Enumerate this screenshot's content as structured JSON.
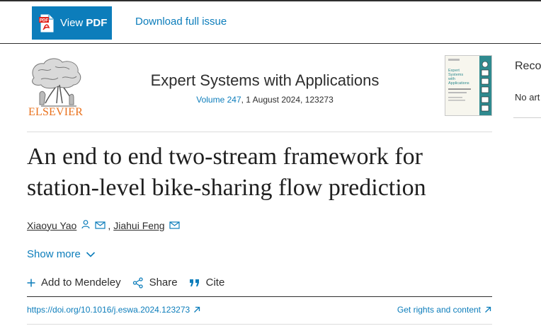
{
  "toolbar": {
    "view_pdf_prefix": "View ",
    "view_pdf_bold": "PDF",
    "pdf_badge": "PDF",
    "download_label": "Download full issue"
  },
  "publisher": {
    "logo_word": "ELSEVIER"
  },
  "journal": {
    "title": "Expert Systems with Applications",
    "volume": "Volume 247",
    "issue_details": ", 1 August 2024, 123273",
    "cover_title_1": "Expert",
    "cover_title_2": "Systems",
    "cover_title_3": "with",
    "cover_title_4": "Applications"
  },
  "sidebar": {
    "title": "Reco",
    "text": "No art"
  },
  "article": {
    "title": "An end to end two-stream framework for station-level bike-sharing flow prediction",
    "authors": [
      {
        "name": "Xiaoyu Yao"
      },
      {
        "name": "Jiahui Feng"
      }
    ],
    "author_separator": ",",
    "show_more": "Show more",
    "doi": "https://doi.org/10.1016/j.eswa.2024.123273",
    "rights": "Get rights and content"
  },
  "actions": {
    "add_mendeley": "Add to Mendeley",
    "share": "Share",
    "cite": "Cite"
  },
  "colors": {
    "link": "#0c7dbb",
    "brand": "#e9711c",
    "text": "#2e2e2e"
  },
  "icons": [
    "pdf-file-icon",
    "person-icon",
    "envelope-icon",
    "chevron-down-icon",
    "plus-icon",
    "share-icon",
    "quote-icon",
    "external-arrow-icon"
  ]
}
